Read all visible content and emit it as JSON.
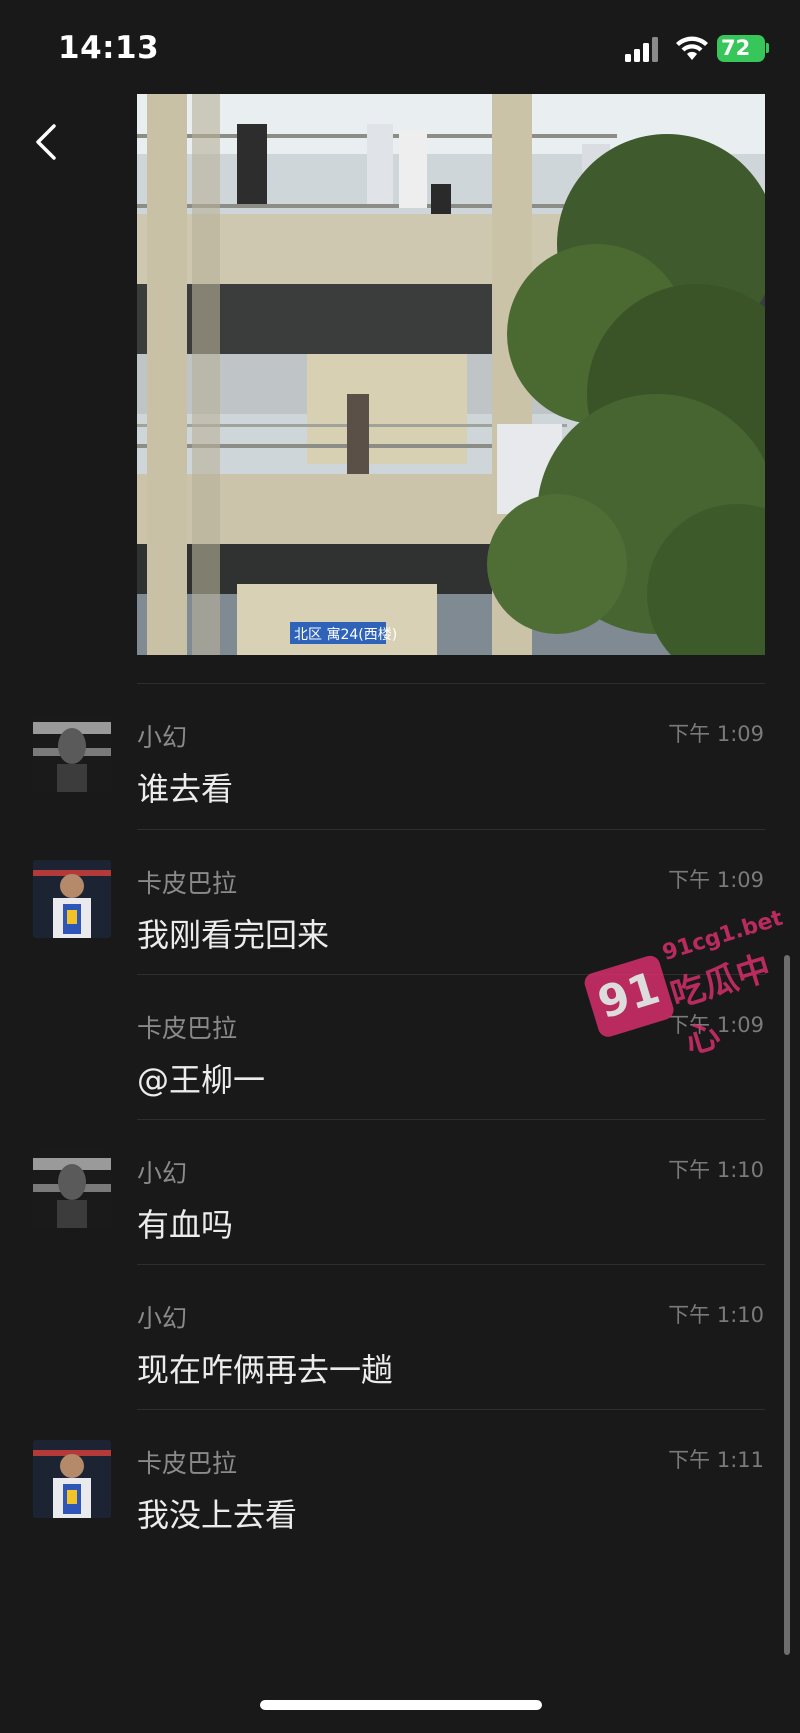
{
  "status_bar": {
    "time": "14:13",
    "battery": "72",
    "battery_color": "#37c65a"
  },
  "header": {
    "back_icon": "chevron-left-icon",
    "more_icon": "ellipsis-icon"
  },
  "photo": {
    "sign_text": "北区 寓24(西楼)"
  },
  "messages": [
    {
      "sender": "小幻",
      "time": "下午 1:09",
      "text": "谁去看",
      "avatar": "avatar-dark-portrait"
    },
    {
      "sender": "卡皮巴拉",
      "time": "下午 1:09",
      "text": "我刚看完回来",
      "avatar": "avatar-basketball-player"
    },
    {
      "sender": "卡皮巴拉",
      "time": "下午 1:09",
      "text": "@王柳一",
      "avatar": ""
    },
    {
      "sender": "小幻",
      "time": "下午 1:10",
      "text": "有血吗",
      "avatar": "avatar-dark-portrait"
    },
    {
      "sender": "小幻",
      "time": "下午 1:10",
      "text": "现在咋俩再去一趟",
      "avatar": ""
    },
    {
      "sender": "卡皮巴拉",
      "time": "下午 1:11",
      "text": "我没上去看",
      "avatar": "avatar-basketball-player"
    }
  ],
  "watermark": {
    "badge": "91",
    "url": "91cg1.bet",
    "name": "吃瓜中心",
    "color": "#d62f6c"
  }
}
